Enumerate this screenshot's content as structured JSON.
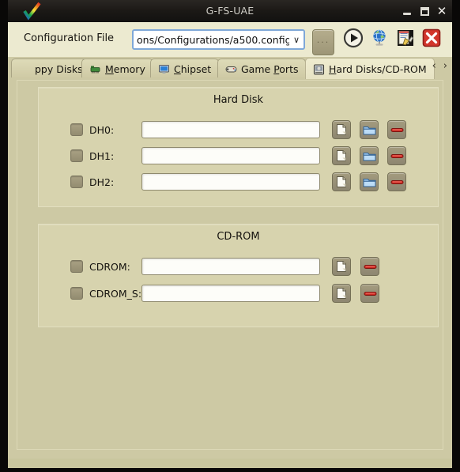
{
  "window": {
    "title": "G-FS-UAE",
    "logo_icon": "fsuae-checkmark-logo-icon",
    "minimize_label": "–",
    "maximize_label": "□",
    "close_label": "✕"
  },
  "toolbar": {
    "config_label": "Configuration File",
    "config_value": "ons/Configurations/a500.config",
    "config_arrow": "∨",
    "browse_label": "...",
    "buttons": [
      {
        "name": "start-button",
        "icon": "play-circle-icon"
      },
      {
        "name": "net-play-button",
        "icon": "globe-icon"
      },
      {
        "name": "edit-config-button",
        "icon": "notepad-pencil-icon"
      },
      {
        "name": "quit-button",
        "icon": "red-x-icon"
      }
    ]
  },
  "tabs": {
    "items": [
      {
        "label": "ppy Disks",
        "icon": "floppy-disk-icon",
        "accel": "",
        "active": false
      },
      {
        "label": "Memory",
        "icon": "memory-chip-icon",
        "accel": "M",
        "active": false
      },
      {
        "label": "Chipset",
        "icon": "monitor-icon",
        "accel": "C",
        "active": false
      },
      {
        "label": "Game Ports",
        "icon": "gamepad-icon",
        "accel": "P",
        "active": false
      },
      {
        "label": "Hard Disks/CD-ROM",
        "icon": "hard-disk-icon",
        "accel": "H",
        "active": true
      }
    ],
    "prev_label": "‹",
    "next_label": "›"
  },
  "hard_disk_group": {
    "title": "Hard Disk",
    "rows": [
      {
        "label": "DH0:",
        "value": "",
        "checked": false
      },
      {
        "label": "DH1:",
        "value": "",
        "checked": false
      },
      {
        "label": "DH2:",
        "value": "",
        "checked": false
      }
    ],
    "buttons": [
      {
        "name": "add-file-button",
        "icon": "document-icon"
      },
      {
        "name": "add-directory-button",
        "icon": "folder-icon"
      },
      {
        "name": "eject-button",
        "icon": "eject-remove-icon"
      }
    ]
  },
  "cdrom_group": {
    "title": "CD-ROM",
    "rows": [
      {
        "label": "CDROM:",
        "value": "",
        "checked": false
      },
      {
        "label": "CDROM_S:",
        "value": "",
        "checked": false
      }
    ],
    "buttons": [
      {
        "name": "add-file-button",
        "icon": "document-icon"
      },
      {
        "name": "eject-button",
        "icon": "eject-remove-icon"
      }
    ]
  },
  "colors": {
    "window_bg": "#c9c69e",
    "page_bg": "#cdc9a4",
    "group_bg": "#d7d3ae",
    "toolbar_bg": "#ecead0",
    "titlebar_bg": "#1b1916",
    "field_bg": "#fdfdf9",
    "combo_focus_border": "#7fa8d8",
    "accent_red": "#cc2222",
    "folder_blue": "#6fa8dc"
  }
}
